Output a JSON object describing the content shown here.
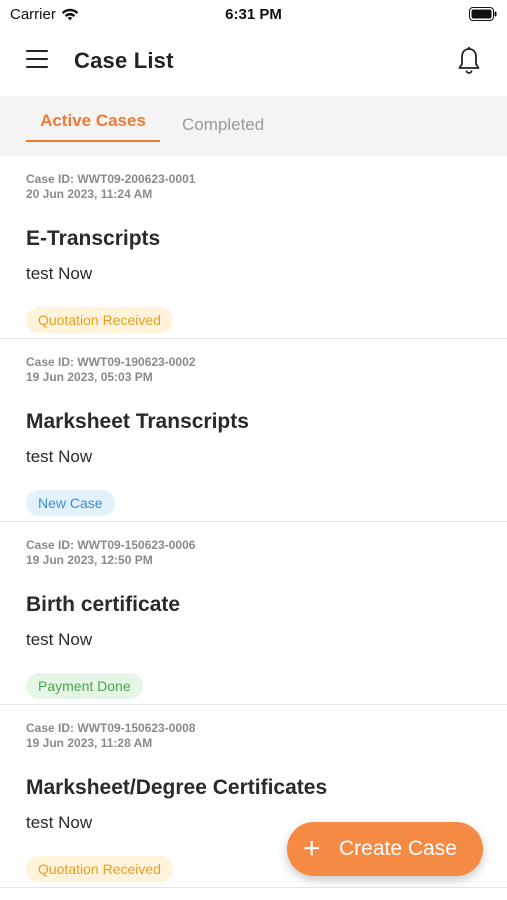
{
  "status_bar": {
    "carrier": "Carrier",
    "time": "6:31 PM",
    "icons": [
      "wifi-icon",
      "battery-icon"
    ]
  },
  "header": {
    "title": "Case List",
    "icons": [
      "menu-icon",
      "bell-icon"
    ]
  },
  "tabs": [
    {
      "label": "Active Cases",
      "active": true
    },
    {
      "label": "Completed",
      "active": false
    }
  ],
  "cases": [
    {
      "case_id": "Case ID: WWT09-200623-0001",
      "date": "20 Jun 2023, 11:24 AM",
      "title": "E-Transcripts",
      "subtitle": "test Now",
      "status": "Quotation Received"
    },
    {
      "case_id": "Case ID: WWT09-190623-0002",
      "date": "19 Jun 2023, 05:03 PM",
      "title": "Marksheet Transcripts",
      "subtitle": "test Now",
      "status": "New Case"
    },
    {
      "case_id": "Case ID: WWT09-150623-0006",
      "date": "19 Jun 2023, 12:50 PM",
      "title": "Birth certificate",
      "subtitle": "test Now",
      "status": "Payment Done"
    },
    {
      "case_id": "Case ID: WWT09-150623-0008",
      "date": "19 Jun 2023, 11:28 AM",
      "title": "Marksheet/Degree Certificates",
      "subtitle": "test Now",
      "status": "Quotation Received"
    }
  ],
  "fab": {
    "plus": "+",
    "label": "Create Case"
  },
  "colors": {
    "accent": "#f07a32",
    "fab": "#f58a45",
    "quotation": "#e6a021",
    "new": "#3b8fd6",
    "paid": "#4aa44e"
  }
}
